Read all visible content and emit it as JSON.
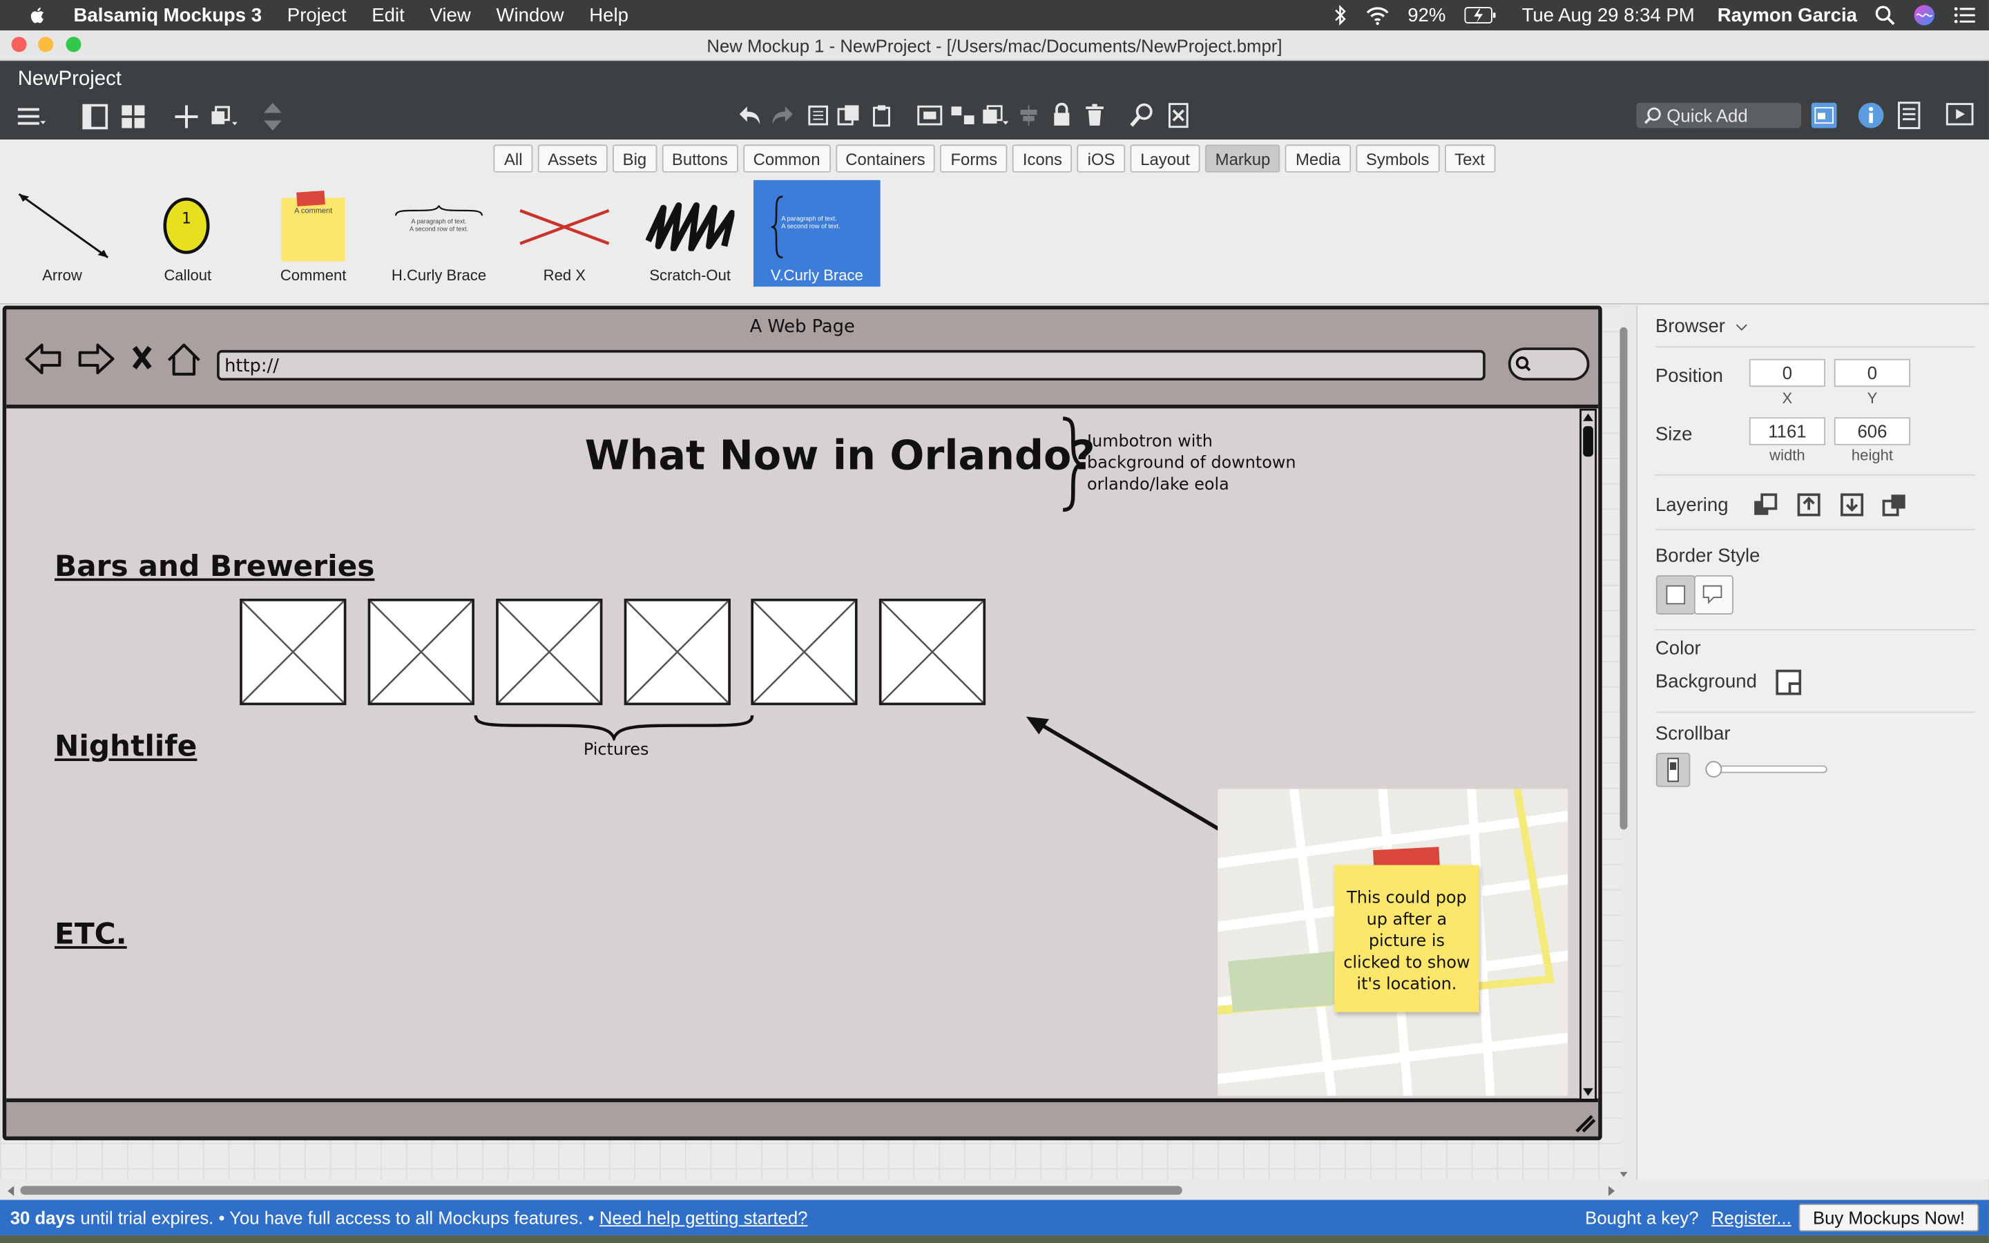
{
  "menubar": {
    "app_name": "Balsamiq Mockups 3",
    "items": [
      "Project",
      "Edit",
      "View",
      "Window",
      "Help"
    ],
    "battery": "92%",
    "datetime": "Tue Aug 29  8:34 PM",
    "user": "Raymon Garcia"
  },
  "window": {
    "title": "New Mockup 1 - NewProject - [/Users/mac/Documents/NewProject.bmpr]"
  },
  "toolbar": {
    "project_name": "NewProject",
    "quick_add_placeholder": "Quick Add"
  },
  "filter_tabs": [
    "All",
    "Assets",
    "Big",
    "Buttons",
    "Common",
    "Containers",
    "Forms",
    "Icons",
    "iOS",
    "Layout",
    "Markup",
    "Media",
    "Symbols",
    "Text"
  ],
  "selected_tab": "Markup",
  "library": {
    "items": [
      "Arrow",
      "Callout",
      "Comment",
      "H.Curly Brace",
      "Red X",
      "Scratch-Out",
      "V.Curly Brace"
    ],
    "selected": "V.Curly Brace",
    "callout_number": "1",
    "comment_text": "A comment",
    "brace_text_1": "A paragraph of text.",
    "brace_text_2": "A second row of text."
  },
  "mockup": {
    "browser_title": "A Web Page",
    "url": "http://",
    "headline": "What Now in Orlando?",
    "jumbotron_note": "Jumbotron with background of downtown orlando/lake eola",
    "sections": [
      "Bars and Breweries",
      "Nightlife",
      "ETC."
    ],
    "pictures_label": "Pictures",
    "sticky_note": "This could pop up after a picture is clicked to show it's location."
  },
  "properties": {
    "component": "Browser",
    "position_label": "Position",
    "x": "0",
    "y": "0",
    "x_caption": "X",
    "y_caption": "Y",
    "size_label": "Size",
    "width": "1161",
    "height": "606",
    "width_caption": "width",
    "height_caption": "height",
    "layering_label": "Layering",
    "border_style_label": "Border Style",
    "color_label": "Color",
    "background_label": "Background",
    "scrollbar_label": "Scrollbar"
  },
  "trial": {
    "days": "30 days",
    "message": "until trial expires. • You have full access to all Mockups features. •",
    "help_link": "Need help getting started?",
    "key_prompt": "Bought a key?",
    "register_link": "Register...",
    "buy_button": "Buy Mockups Now!"
  },
  "colors": {
    "accent": "#3b7dd8",
    "trial_banner": "#2f6fc7",
    "sticky": "#fde66c",
    "browser_fill": "#d7d1d1"
  }
}
